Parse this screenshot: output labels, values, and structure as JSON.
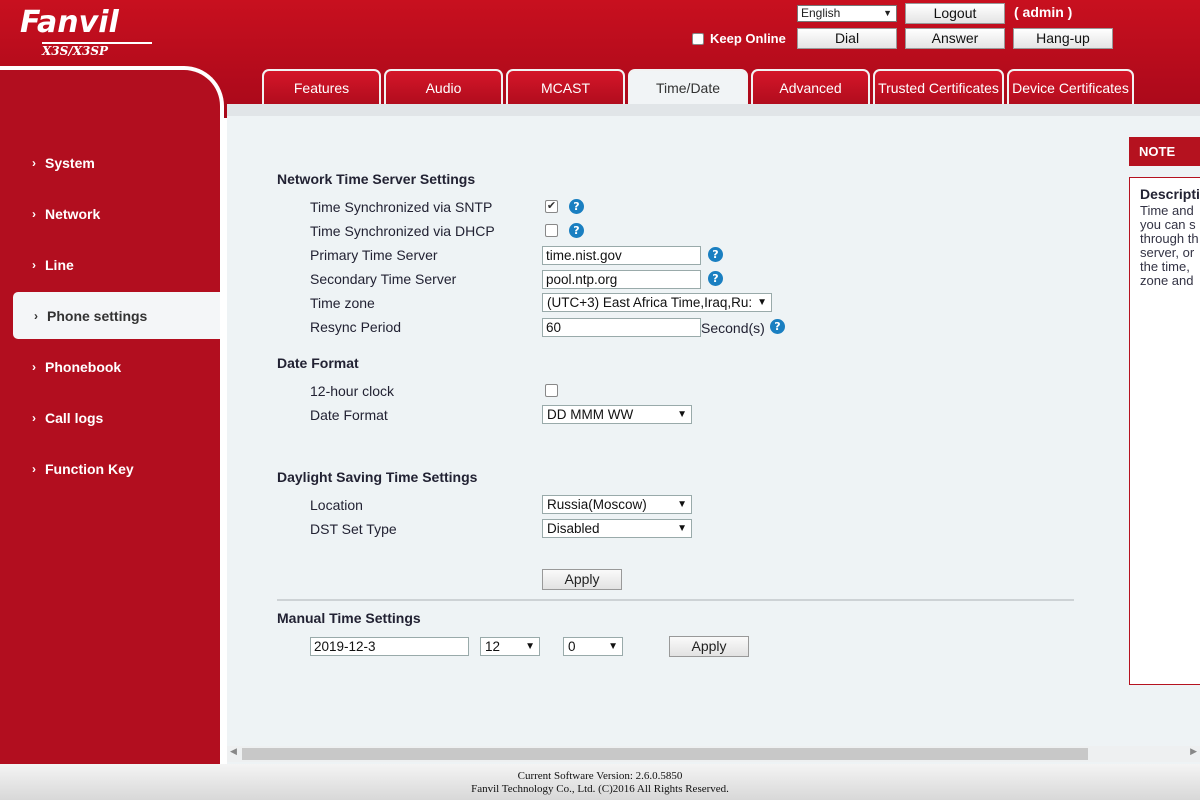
{
  "header": {
    "brand": "Fanvil",
    "model": "X3S/X3SP",
    "language": "English",
    "logout_label": "Logout",
    "user": "( admin )",
    "keep_online_label": "Keep Online",
    "dial_label": "Dial",
    "answer_label": "Answer",
    "hangup_label": "Hang-up"
  },
  "tabs": [
    {
      "label": "Features"
    },
    {
      "label": "Audio"
    },
    {
      "label": "MCAST"
    },
    {
      "label": "Time/Date",
      "active": true
    },
    {
      "label": "Advanced"
    },
    {
      "label": "Trusted Certificates"
    },
    {
      "label": "Device Certificates"
    }
  ],
  "sidebar": {
    "items": [
      {
        "label": "System"
      },
      {
        "label": "Network"
      },
      {
        "label": "Line"
      },
      {
        "label": "Phone settings",
        "active": true
      },
      {
        "label": "Phonebook"
      },
      {
        "label": "Call logs"
      },
      {
        "label": "Function Key"
      }
    ]
  },
  "ntp": {
    "title": "Network Time Server Settings",
    "sntp_label": "Time Synchronized via SNTP",
    "sntp_checked": true,
    "dhcp_label": "Time Synchronized via DHCP",
    "dhcp_checked": false,
    "primary_label": "Primary Time Server",
    "primary_value": "time.nist.gov",
    "secondary_label": "Secondary Time Server",
    "secondary_value": "pool.ntp.org",
    "timezone_label": "Time zone",
    "timezone_value": "(UTC+3) East Africa Time,Iraq,Ru:",
    "resync_label": "Resync Period",
    "resync_value": "60",
    "resync_unit": "Second(s)"
  },
  "date_format": {
    "title": "Date Format",
    "clock12_label": "12-hour clock",
    "clock12_checked": false,
    "format_label": "Date Format",
    "format_value": "DD MMM WW"
  },
  "dst": {
    "title": "Daylight Saving Time Settings",
    "location_label": "Location",
    "location_value": "Russia(Moscow)",
    "type_label": "DST Set Type",
    "type_value": "Disabled",
    "apply_label": "Apply"
  },
  "manual": {
    "title": "Manual Time Settings",
    "date_value": "2019-12-3",
    "hour_value": "12",
    "minute_value": "0",
    "apply_label": "Apply"
  },
  "note": {
    "header": "NOTE",
    "title": "Descripti",
    "lines": [
      "Time and",
      "you can s",
      "through th",
      "server, or",
      "the time, ",
      "zone and "
    ]
  },
  "footer": {
    "version": "Current Software Version: 2.6.0.5850",
    "copyright": "Fanvil Technology Co., Ltd. (C)2016 All Rights Reserved."
  },
  "colors": {
    "brand_red": "#b20e1f",
    "help_blue": "#1a7fc1"
  }
}
